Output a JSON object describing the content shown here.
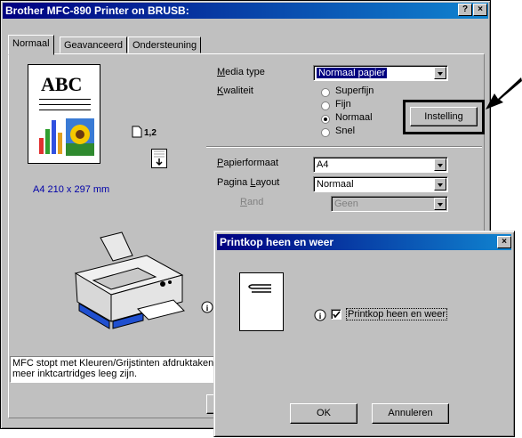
{
  "window": {
    "title": "Brother MFC-890 Printer on BRUSB:",
    "help_btn": "?",
    "close_btn": "×"
  },
  "tabs": [
    {
      "label": "Normaal",
      "active": true
    },
    {
      "label": "Geavanceerd",
      "active": false
    },
    {
      "label": "Ondersteuning",
      "active": false
    }
  ],
  "preview": {
    "abc": "ABC",
    "copies": "1,2",
    "paper_size": "A4 210 x 297 mm"
  },
  "media": {
    "label": "Media type",
    "value": "Normaal papier"
  },
  "quality": {
    "label": "Kwaliteit",
    "options": [
      {
        "label": "Superfijn",
        "selected": false
      },
      {
        "label": "Fijn",
        "selected": false
      },
      {
        "label": "Normaal",
        "selected": true
      },
      {
        "label": "Snel",
        "selected": false
      }
    ],
    "setting_button": "Instelling"
  },
  "paper": {
    "label": "Papierformaat",
    "value": "A4"
  },
  "layout": {
    "label": "Pagina Layout",
    "value": "Normaal"
  },
  "border": {
    "label": "Rand",
    "value": "Geen"
  },
  "status_text": "MFC stopt met Kleuren/Grijstinten afdrukken wanneer een of meer inktcartridges leeg zijn.",
  "status_line1": "MFC stopt met Kleuren/Grijstinten afdruktaken",
  "status_line2": "meer inktcartridges leeg zijn.",
  "dialog": {
    "title": "Printkop heen en weer",
    "checkbox_label": "Printkop heen en weer",
    "checked": true,
    "ok": "OK",
    "cancel": "Annuleren"
  },
  "colors": {
    "title_start": "#000080",
    "title_end": "#1084d0",
    "face": "#c0c0c0",
    "link": "#0000a8"
  },
  "icons": [
    "info-icon",
    "printer-icon",
    "page-icon",
    "arrow-down-icon",
    "pointer-arrow-icon"
  ]
}
